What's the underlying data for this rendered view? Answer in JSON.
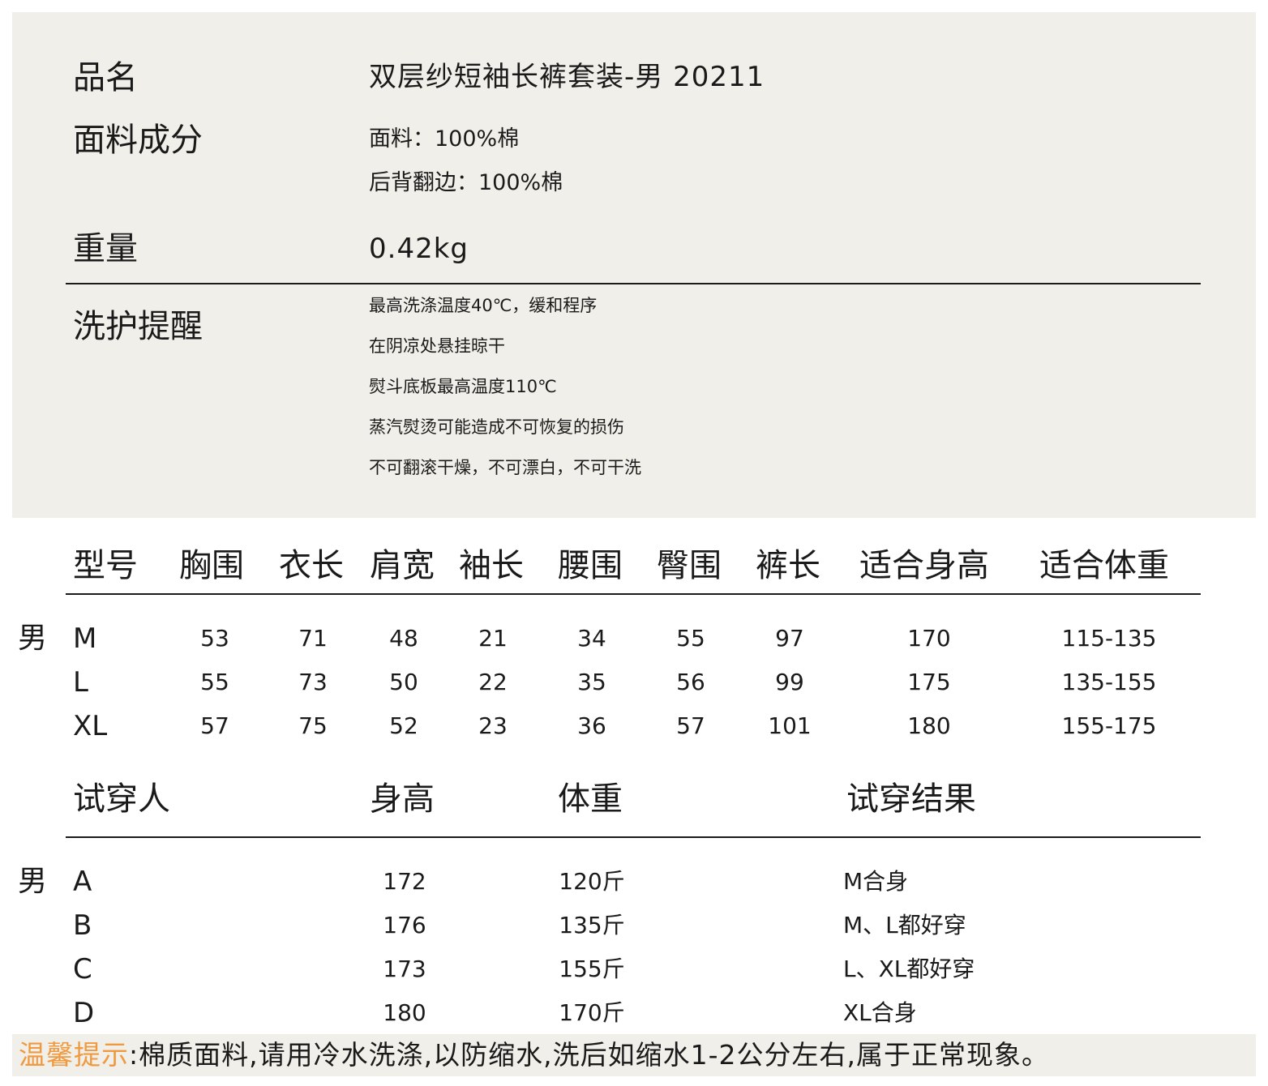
{
  "info": {
    "name_label": "品名",
    "name_value": "双层纱短袖长裤套装-男 20211",
    "fabric_label": "面料成分",
    "fabric_lines": [
      "面料：100%棉",
      "后背翻边：100%棉"
    ],
    "weight_label": "重量",
    "weight_value": "0.42kg",
    "care_label": "洗护提醒",
    "care_lines": [
      "最高洗涤温度40℃，缓和程序",
      "在阴凉处悬挂晾干",
      "熨斗底板最高温度110℃",
      "蒸汽熨烫可能造成不可恢复的损伤",
      "不可翻滚干燥，不可漂白，不可干洗"
    ]
  },
  "size_table": {
    "headers": [
      "型号",
      "胸围",
      "衣长",
      "肩宽",
      "袖长",
      "腰围",
      "臀围",
      "裤长",
      "适合身高",
      "适合体重"
    ],
    "gender": "男",
    "rows": [
      [
        "M",
        "53",
        "71",
        "48",
        "21",
        "34",
        "55",
        "97",
        "170",
        "115-135"
      ],
      [
        "L",
        "55",
        "73",
        "50",
        "22",
        "35",
        "56",
        "99",
        "175",
        "135-155"
      ],
      [
        "XL",
        "57",
        "75",
        "52",
        "23",
        "36",
        "57",
        "101",
        "180",
        "155-175"
      ]
    ]
  },
  "fit_table": {
    "headers": [
      "试穿人",
      "身高",
      "体重",
      "试穿结果"
    ],
    "gender": "男",
    "rows": [
      [
        "A",
        "172",
        "120斤",
        "M合身"
      ],
      [
        "B",
        "176",
        "135斤",
        "M、L都好穿"
      ],
      [
        "C",
        "173",
        "155斤",
        "L、XL都好穿"
      ],
      [
        "D",
        "180",
        "170斤",
        "XL合身"
      ]
    ]
  },
  "tip": {
    "label": "温馨提示",
    "text": ":棉质面料,请用冷水洗涤,以防缩水,洗后如缩水1-2公分左右,属于正常现象。"
  },
  "colors": {
    "panel_bg": "#f1efe9",
    "tip_label": "#f0993f",
    "text": "#1a1a1a"
  }
}
